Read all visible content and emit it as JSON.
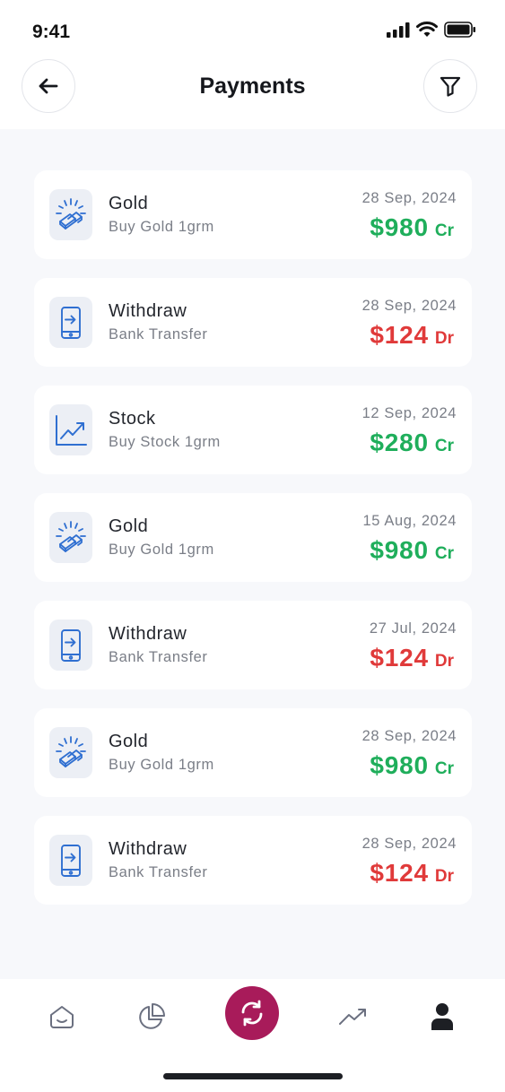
{
  "status_bar": {
    "time": "9:41"
  },
  "header": {
    "title": "Payments"
  },
  "colors": {
    "credit": "#1fae5b",
    "debit": "#e03a3a",
    "accent": "#a81b5a",
    "icon_blue": "#2f6fd1"
  },
  "transactions": [
    {
      "icon": "gold-bars-icon",
      "title": "Gold",
      "subtitle": "Buy Gold 1grm",
      "date": "28 Sep, 2024",
      "amount": "$980",
      "type": "Cr"
    },
    {
      "icon": "phone-transfer-icon",
      "title": "Withdraw",
      "subtitle": "Bank Transfer",
      "date": "28 Sep, 2024",
      "amount": "$124",
      "type": "Dr"
    },
    {
      "icon": "stock-chart-icon",
      "title": "Stock",
      "subtitle": "Buy Stock 1grm",
      "date": "12 Sep, 2024",
      "amount": "$280",
      "type": "Cr"
    },
    {
      "icon": "gold-bars-icon",
      "title": "Gold",
      "subtitle": "Buy Gold 1grm",
      "date": "15 Aug, 2024",
      "amount": "$980",
      "type": "Cr"
    },
    {
      "icon": "phone-transfer-icon",
      "title": "Withdraw",
      "subtitle": "Bank Transfer",
      "date": "27 Jul, 2024",
      "amount": "$124",
      "type": "Dr"
    },
    {
      "icon": "gold-bars-icon",
      "title": "Gold",
      "subtitle": "Buy Gold 1grm",
      "date": "28 Sep, 2024",
      "amount": "$980",
      "type": "Cr"
    },
    {
      "icon": "phone-transfer-icon",
      "title": "Withdraw",
      "subtitle": "Bank Transfer",
      "date": "28 Sep, 2024",
      "amount": "$124",
      "type": "Dr"
    }
  ],
  "bottom_nav": {
    "items": [
      {
        "icon": "home-icon",
        "active": false
      },
      {
        "icon": "pie-chart-icon",
        "active": false
      },
      {
        "icon": "refresh-icon",
        "active": true
      },
      {
        "icon": "trending-up-icon",
        "active": false
      },
      {
        "icon": "user-icon",
        "active": false
      }
    ]
  }
}
